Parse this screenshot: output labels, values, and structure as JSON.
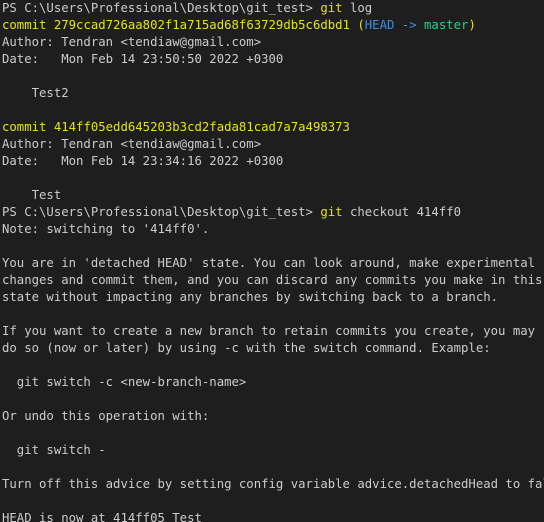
{
  "colors": {
    "background": "#1e1e1e",
    "foreground": "#cccccc",
    "yellow": "#e5e510",
    "blue": "#3b8eea",
    "green": "#23d18b"
  },
  "terminal": {
    "prompt": "PS C:\\Users\\Professional\\Desktop\\git_test> ",
    "cmd1": "git",
    "cmd1_args": " log",
    "commit1": {
      "prefix": "commit ",
      "hash": "279ccad726aa802f1a715ad68f63729db5c6dbd1",
      "paren_open": " (",
      "head": "HEAD -> ",
      "branch": "master",
      "paren_close": ")",
      "author": "Author: Tendran <tendiaw@gmail.com>",
      "date": "Date:   Mon Feb 14 23:50:50 2022 +0300",
      "message": "    Test2"
    },
    "commit2": {
      "prefix": "commit ",
      "hash": "414ff05edd645203b3cd2fada81cad7a7a498373",
      "author": "Author: Tendran <tendiaw@gmail.com>",
      "date": "Date:   Mon Feb 14 23:34:16 2022 +0300",
      "message": "    Test"
    },
    "cmd2": "git",
    "cmd2_args": " checkout 414ff0",
    "output": [
      "Note: switching to '414ff0'.",
      "",
      "You are in 'detached HEAD' state. You can look around, make experimental",
      "changes and commit them, and you can discard any commits you make in this",
      "state without impacting any branches by switching back to a branch.",
      "",
      "If you want to create a new branch to retain commits you create, you may",
      "do so (now or later) by using -c with the switch command. Example:",
      "",
      "  git switch -c <new-branch-name>",
      "",
      "Or undo this operation with:",
      "",
      "  git switch -",
      "",
      "Turn off this advice by setting config variable advice.detachedHead to false",
      "",
      "HEAD is now at 414ff05 Test"
    ]
  }
}
